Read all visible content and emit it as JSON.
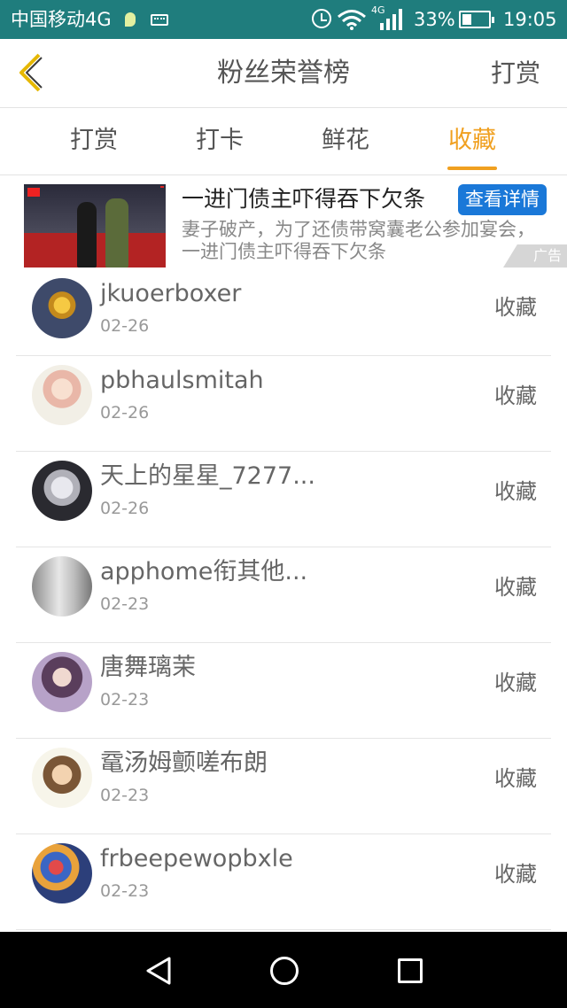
{
  "status_bar": {
    "carrier": "中国移动4G",
    "network_type": "4G",
    "battery_percent": "33%",
    "battery_level": 0.33,
    "time": "19:05"
  },
  "header": {
    "title": "粉丝荣誉榜",
    "action_label": "打赏"
  },
  "tabs": [
    {
      "label": "打赏",
      "active": false
    },
    {
      "label": "打卡",
      "active": false
    },
    {
      "label": "鲜花",
      "active": false
    },
    {
      "label": "收藏",
      "active": true
    }
  ],
  "ad": {
    "title": "一进门债主吓得吞下欠条",
    "description": "妻子破产，为了还债带窝囊老公参加宴会，一进门债主吓得吞下欠条",
    "button_label": "查看详情",
    "label": "广告"
  },
  "list": [
    {
      "name": "jkuoerboxer",
      "date": "02-26",
      "action": "收藏"
    },
    {
      "name": "pbhaulsmitah",
      "date": "02-26",
      "action": "收藏"
    },
    {
      "name": "天上的星星_7277...",
      "date": "02-26",
      "action": "收藏"
    },
    {
      "name": "apphome衔其他...",
      "date": "02-23",
      "action": "收藏"
    },
    {
      "name": "唐舞璃茉",
      "date": "02-23",
      "action": "收藏"
    },
    {
      "name": "鼋汤姆颤嗟布朗",
      "date": "02-23",
      "action": "收藏"
    },
    {
      "name": "frbeepewopbxle",
      "date": "02-23",
      "action": "收藏"
    }
  ],
  "colors": {
    "status_bar": "#1f7d7d",
    "accent": "#f0a020",
    "ad_button": "#1a78d8"
  }
}
